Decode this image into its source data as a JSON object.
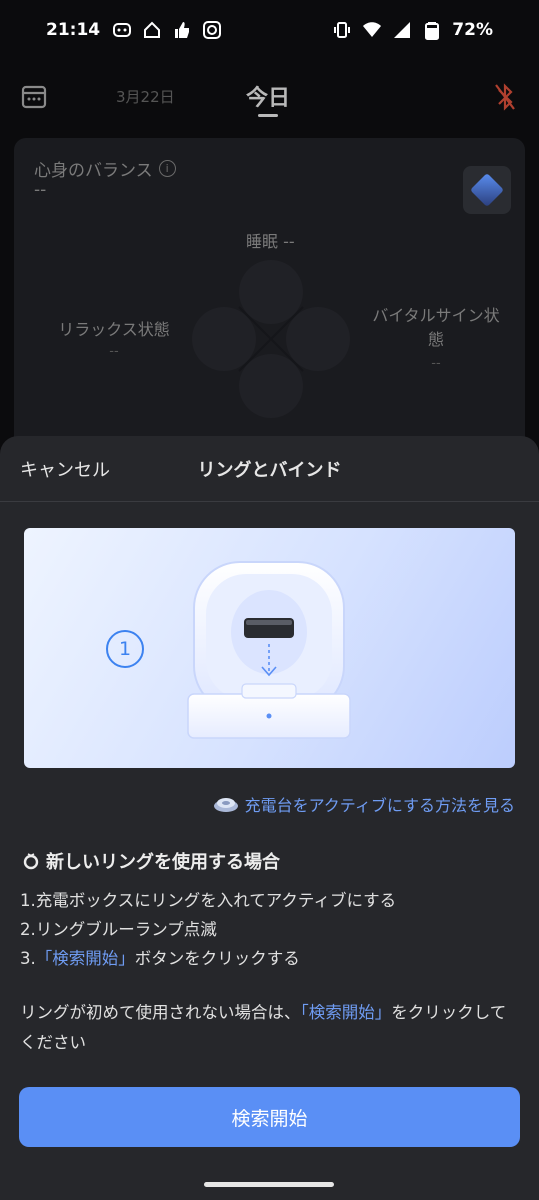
{
  "status_bar": {
    "time": "21:14",
    "battery": "72%",
    "notification_icons": [
      "app-icon",
      "home-icon",
      "thumbs-up-icon",
      "app-icon-2"
    ]
  },
  "header": {
    "prev_date": "3月22日",
    "today": "今日"
  },
  "balance_card": {
    "title": "心身のバランス",
    "value": "--",
    "sleep": "睡眠 --",
    "relax": "リラックス状態",
    "relax_value": "--",
    "vital_line1": "バイタルサイン状",
    "vital_line2": "態",
    "vital_value": "--"
  },
  "sheet": {
    "cancel": "キャンセル",
    "title": "リングとバインド",
    "step_badge": "1",
    "activate_link": "充電台をアクティブにする方法を見る",
    "new_ring_title": "新しいリングを使用する場合",
    "step1": "1.充電ボックスにリングを入れてアクティブにする",
    "step2": "2.リングブルーランプ点滅",
    "step3_prefix": "3.",
    "step3_highlight": "「検索開始」",
    "step3_suffix": "ボタンをクリックする",
    "note_prefix": "リングが初めて使用されない場合は、",
    "note_highlight": "「検索開始」",
    "note_suffix": "をクリックしてください",
    "search_button": "検索開始"
  },
  "colors": {
    "accent": "#5a8ff5",
    "link": "#6f9cf3",
    "sheet_bg": "#26272b",
    "bg": "#0b0b0d"
  }
}
